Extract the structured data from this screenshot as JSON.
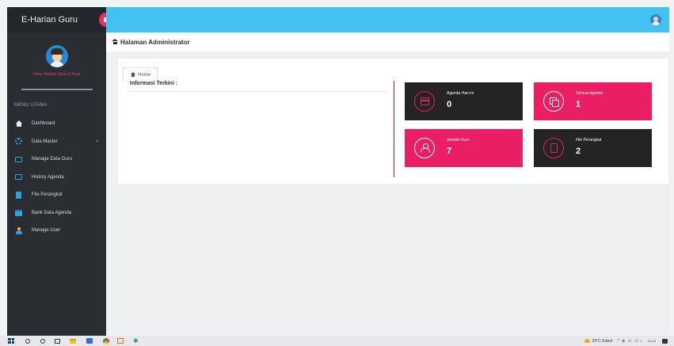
{
  "sidebar": {
    "brand_title": "E-Harian Guru",
    "username": "Vony Hadiat Jaya,S.Kom",
    "menu_title": "MENU UTAMA",
    "items": [
      {
        "label": "Dashboard",
        "icon": "home-icon"
      },
      {
        "label": "Data Master",
        "icon": "gears-icon",
        "caret": "›"
      },
      {
        "label": "Manage Data Guru",
        "icon": "folder-icon"
      },
      {
        "label": "History Agenda",
        "icon": "folder-icon"
      },
      {
        "label": "File Perangkat",
        "icon": "file-icon"
      },
      {
        "label": "Bank Data Agenda",
        "icon": "calendar-icon"
      },
      {
        "label": "Manage User",
        "icon": "user-icon"
      }
    ]
  },
  "header": {
    "page_title": "Halaman Administrator"
  },
  "panel": {
    "tab_label": "Home",
    "info_title": "Informasi Terkini :"
  },
  "stats": [
    {
      "label": "Agenda Hari ini",
      "value": "0",
      "icon": "calendar-icon",
      "style": "dark"
    },
    {
      "label": "Semua Agenda",
      "value": "1",
      "icon": "copy-icon",
      "style": "pink"
    },
    {
      "label": "Jumlah Guru",
      "value": "7",
      "icon": "user-icon",
      "style": "pink"
    },
    {
      "label": "File Perangkat",
      "value": "2",
      "icon": "file-icon",
      "style": "dark"
    }
  ],
  "taskbar": {
    "weather": "23°C Kabut",
    "tray_icons": "^ ⊕ ▭ ◁ ⌂",
    "time": "21:12"
  },
  "colors": {
    "topbar": "#43c2f2",
    "sidebar": "#2a2e33",
    "pink": "#e91e63",
    "dark_card": "#242424"
  }
}
